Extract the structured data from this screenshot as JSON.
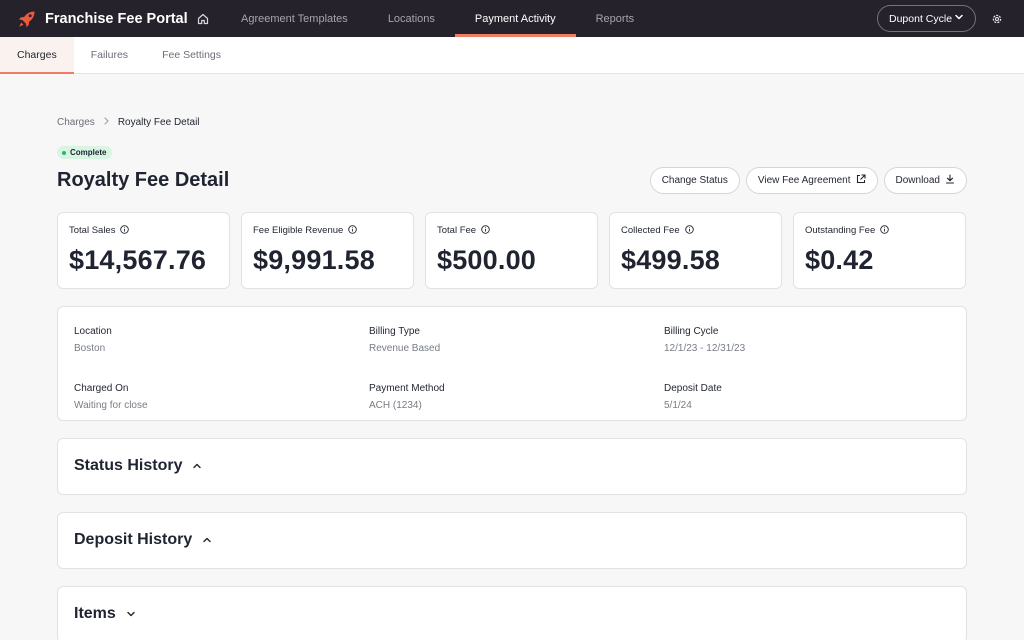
{
  "app": {
    "title": "Franchise Fee Portal",
    "accent_color": "#ee7d63"
  },
  "topnav": {
    "items": [
      {
        "label": "Agreement Templates",
        "active": false
      },
      {
        "label": "Locations",
        "active": false
      },
      {
        "label": "Payment Activity",
        "active": true
      },
      {
        "label": "Reports",
        "active": false
      }
    ],
    "account_label": "Dupont Cycle"
  },
  "subnav": {
    "tabs": [
      {
        "label": "Charges",
        "active": true
      },
      {
        "label": "Failures",
        "active": false
      },
      {
        "label": "Fee Settings",
        "active": false
      }
    ]
  },
  "breadcrumb": {
    "parent": "Charges",
    "separator": ">",
    "current": "Royalty Fee Detail"
  },
  "status_badge": {
    "label": "Complete",
    "color": "#2fb26a"
  },
  "page": {
    "title": "Royalty Fee Detail"
  },
  "actions": {
    "change_status": "Change Status",
    "view_agreement": "View Fee Agreement",
    "download": "Download"
  },
  "stats": [
    {
      "label": "Total Sales",
      "value": "$14,567.76"
    },
    {
      "label": "Fee Eligible Revenue",
      "value": "$9,991.58"
    },
    {
      "label": "Total Fee",
      "value": "$500.00"
    },
    {
      "label": "Collected Fee",
      "value": "$499.58"
    },
    {
      "label": "Outstanding Fee",
      "value": "$0.42"
    }
  ],
  "details": [
    {
      "label": "Location",
      "value": "Boston"
    },
    {
      "label": "Billing Type",
      "value": "Revenue Based"
    },
    {
      "label": "Billing Cycle",
      "value": "12/1/23 - 12/31/23"
    },
    {
      "label": "Charged On",
      "value": "Waiting for close"
    },
    {
      "label": "Payment Method",
      "value": "ACH (1234)"
    },
    {
      "label": "Deposit Date",
      "value": "5/1/24"
    }
  ],
  "sections": [
    {
      "title": "Status History",
      "expanded": true
    },
    {
      "title": "Deposit History",
      "expanded": true
    },
    {
      "title": "Items",
      "expanded": false
    }
  ]
}
